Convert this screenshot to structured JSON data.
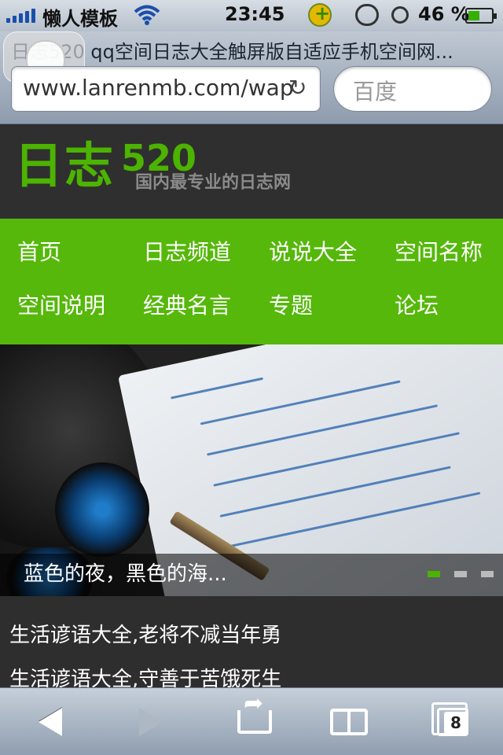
{
  "status_bar": {
    "carrier": "懒人模板",
    "time": "23:45",
    "battery_percent": "46 %",
    "battery_level": 0.46
  },
  "browser": {
    "page_title": "日志520 qq空间日志大全触屏版自适应手机空间网...",
    "url": "www.lanrenmb.com/wap",
    "search_placeholder": "百度",
    "tabs_count": "8"
  },
  "site": {
    "logo_main": "日志",
    "logo_number": "520",
    "logo_tagline": "国内最专业的日志网",
    "brand_color": "#55b80a"
  },
  "nav": {
    "items": [
      {
        "label": "首页"
      },
      {
        "label": "日志频道"
      },
      {
        "label": "说说大全"
      },
      {
        "label": "空间名称"
      },
      {
        "label": "空间说明"
      },
      {
        "label": "经典名言"
      },
      {
        "label": "专题"
      },
      {
        "label": "论坛"
      }
    ]
  },
  "banner": {
    "caption": "蓝色的夜，黑色的海...",
    "slides": 3,
    "active_slide": 1
  },
  "articles": [
    {
      "title": "生活谚语大全,老将不减当年勇"
    },
    {
      "title": "生活谚语大全,守善于苦饿死生"
    }
  ]
}
